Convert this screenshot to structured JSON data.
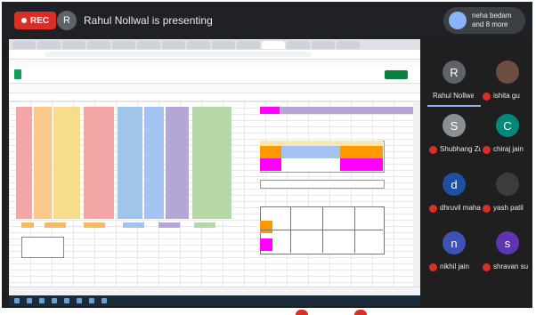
{
  "meeting": {
    "rec_label": "REC",
    "presenter_initial": "R",
    "presenting_text": "Rahul Nollwal is presenting",
    "others_line1": "neha bedam",
    "others_line2": "and 8 more"
  },
  "participants": [
    {
      "initial": "R",
      "name": "Rahul Nollwal",
      "color": "#5f6368",
      "speaking": true
    },
    {
      "initial": "",
      "name": "ishita gu",
      "color": "#6d4c41",
      "speaking": false
    },
    {
      "initial": "S",
      "name": "Shubhang Zu...",
      "color": "#8a8f94",
      "speaking": false
    },
    {
      "initial": "C",
      "name": "chiraj jain",
      "color": "#00897b",
      "speaking": false
    },
    {
      "initial": "d",
      "name": "dhruvil maha...",
      "color": "#1e4fa0",
      "speaking": false
    },
    {
      "initial": "",
      "name": "yash patil",
      "color": "#3c3c3c",
      "speaking": false
    },
    {
      "initial": "n",
      "name": "nikhil jain",
      "color": "#3f51b5",
      "speaking": false
    },
    {
      "initial": "s",
      "name": "shravan su",
      "color": "#5e35b1",
      "speaking": false
    }
  ],
  "colors": {
    "rec": "#d93025",
    "sheet_columns": [
      "#f4a6a6",
      "#fbc98a",
      "#f7dc8c",
      "#f4a6a6",
      "#9fc5e8",
      "#a4c2f4",
      "#b4a7d6",
      "#b6d7a8"
    ],
    "accent_orange": "#ff9900",
    "accent_magenta": "#ff00ff"
  }
}
